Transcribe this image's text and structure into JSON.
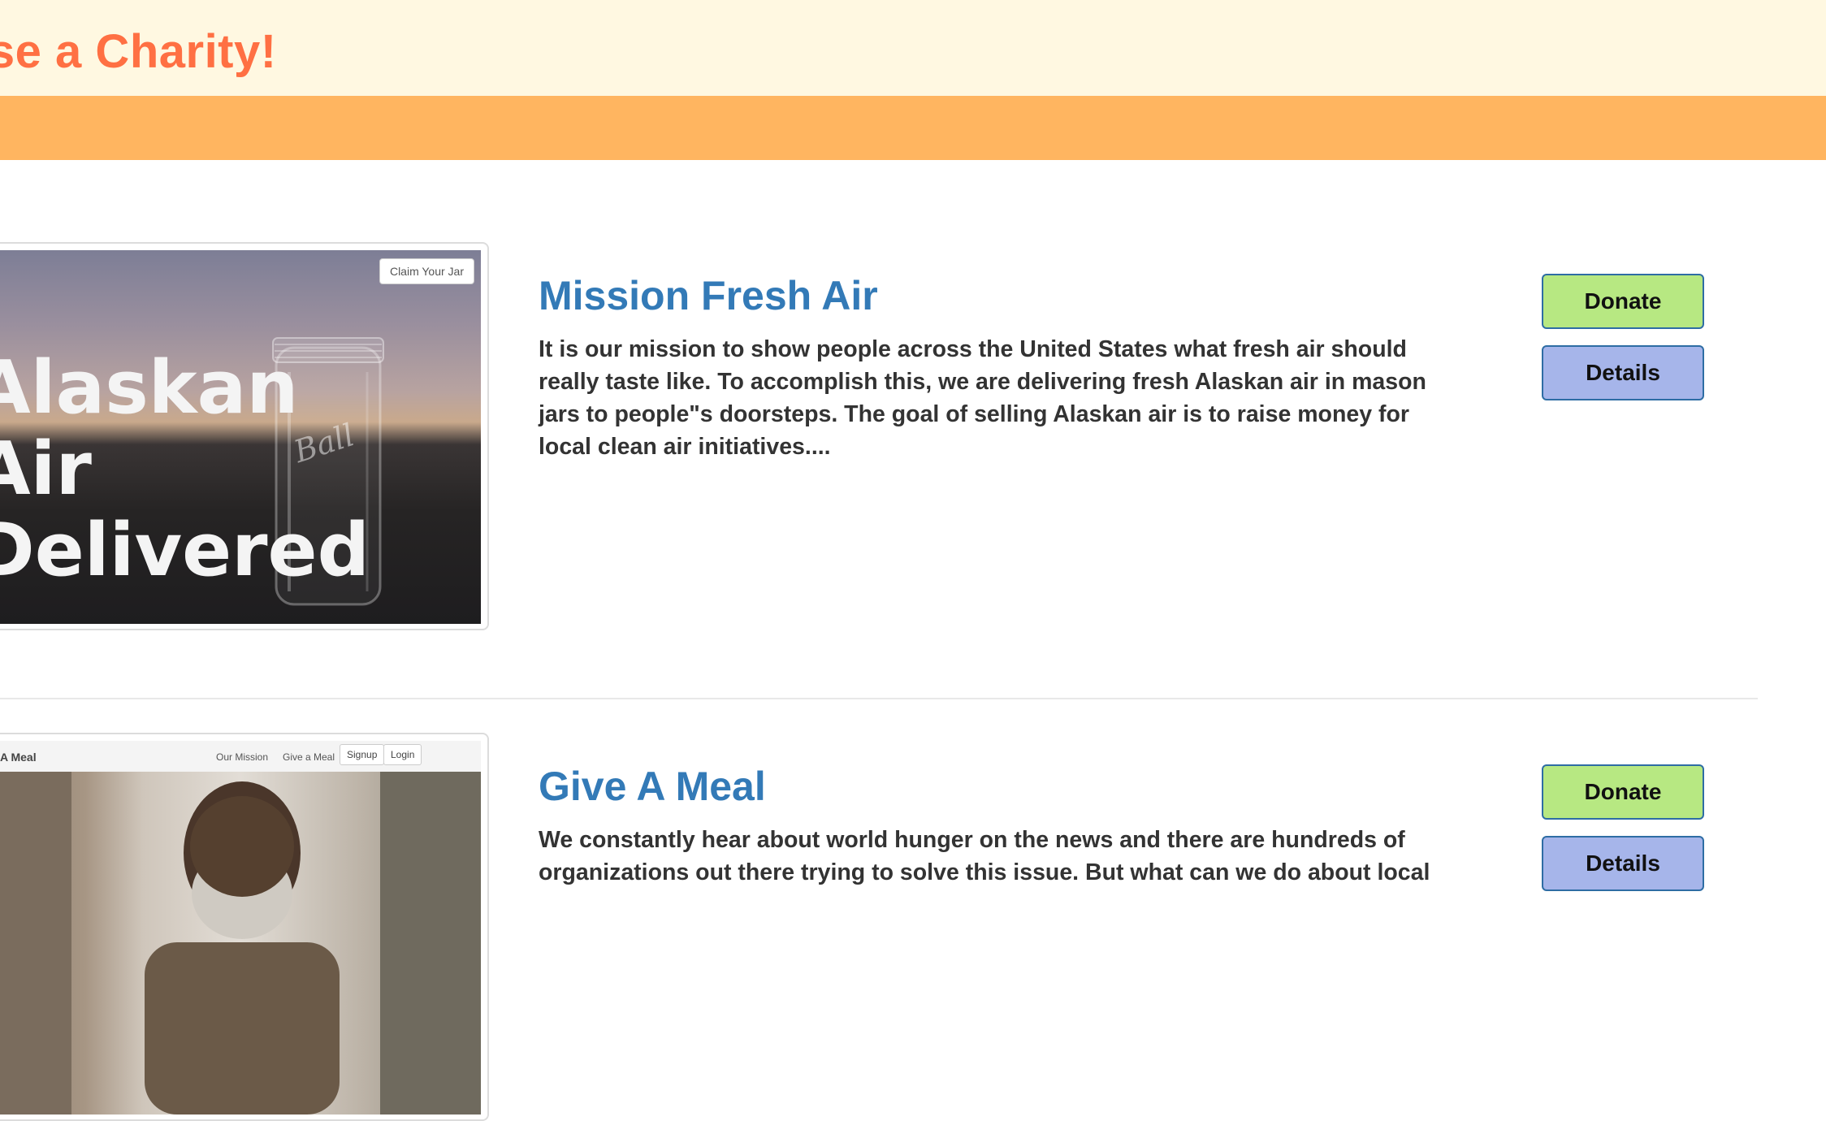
{
  "header": {
    "title": "ose a Charity!"
  },
  "charities": [
    {
      "name": "Mission Fresh Air",
      "description": "It is our mission to show people across the United States what fresh air should really taste like. To accomplish this, we are delivering fresh Alaskan air in mason jars to people\"s doorsteps. The goal of selling Alaskan air is to raise money for local clean air initiatives....",
      "donate_label": "Donate",
      "details_label": "Details",
      "image": {
        "overlay_lines": [
          "Alaskan",
          "Air",
          "Delivered"
        ],
        "button_label": "Claim Your Jar"
      }
    },
    {
      "name": "Give A Meal",
      "description": "We constantly hear about world hunger on the news and there are hundreds of organizations out there trying to solve this issue. But what can we do about local",
      "donate_label": "Donate",
      "details_label": "Details",
      "image": {
        "brand": "A Meal",
        "nav_links": [
          "Our Mission",
          "Give a Meal"
        ],
        "nav_buttons": [
          "Signup",
          "Login"
        ]
      }
    }
  ],
  "colors": {
    "title": "#ff7043",
    "topbar": "#fff8e1",
    "band": "#ffb560",
    "link": "#337ab7",
    "donate": "#b7e882",
    "details": "#a6b5ea"
  }
}
